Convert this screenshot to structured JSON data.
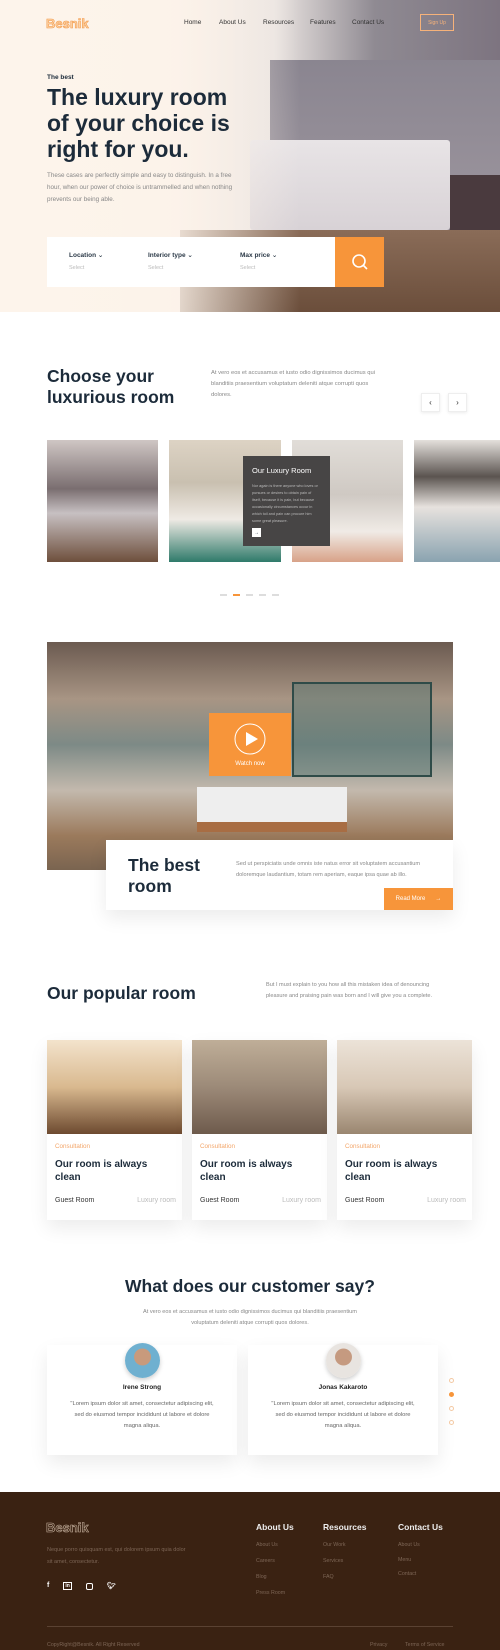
{
  "brand": "Besnik",
  "nav": {
    "items": [
      "Home",
      "About Us",
      "Resources",
      "Features",
      "Contact Us"
    ],
    "signup": "Sign Up"
  },
  "hero": {
    "eyebrow": "The best",
    "title_lines": [
      "The luxury room",
      "of your choice is",
      "right for you."
    ],
    "description": "These cases are perfectly simple and easy to distinguish. In a free hour, when our power of choice is untrammelled and when nothing prevents our being able.",
    "search": {
      "fields": [
        {
          "label": "Location",
          "value": "Select"
        },
        {
          "label": "Interior type",
          "value": "Select"
        },
        {
          "label": "Max price",
          "value": "Select"
        }
      ],
      "button_icon": "search-icon"
    }
  },
  "choose": {
    "title_lines": [
      "Choose your",
      "luxurious room"
    ],
    "description": "At vero eos et accusamus et iusto odio dignissimos ducimus qui blanditiis praesentium voluptatum deleniti atque corrupti quos dolores.",
    "prev": "‹",
    "next": "›",
    "overlay": {
      "title": "Our Luxury Room",
      "text": "Nor again is there anyone who loves or pursues or desires to obtain pain of itself, because it is pain, but because occasionally circumstances occur in which toil and pain can procure him some great pleasure.",
      "arrow": "→"
    },
    "active_dot": 1,
    "dot_count": 5
  },
  "video": {
    "watch": "Watch now",
    "title_lines": [
      "The best",
      "room"
    ],
    "description": "Sed ut perspiciatis unde omnis iste natus error sit voluptatem accusantium doloremque laudantium, totam rem aperiam, eaque ipsa quae ab illo.",
    "read_more": "Read More"
  },
  "popular": {
    "title": "Our popular room",
    "description": "But I must explain to you how all this mistaken idea of denouncing pleasure and praising pain was born and I will give you a complete.",
    "cards": [
      {
        "category": "Consultation",
        "title": "Our room is always clean",
        "type": "Guest Room",
        "tag": "Luxury room"
      },
      {
        "category": "Consultation",
        "title": "Our room is always clean",
        "type": "Guest Room",
        "tag": "Luxury room"
      },
      {
        "category": "Consultation",
        "title": "Our room is always clean",
        "type": "Guest Room",
        "tag": "Luxury room"
      }
    ]
  },
  "testimonials": {
    "title": "What does our customer say?",
    "description": "At vero eos et accusamus et iusto odio dignissimos ducimus qui blanditiis praesentium voluptatum deleniti atque corrupti quos dolores.",
    "items": [
      {
        "name": "Irene Strong",
        "quote": "\"Lorem ipsum dolor sit amet, consectetur adipiscing elit, sed do eiusmod tempor incididunt ut labore et dolore magna aliqua."
      },
      {
        "name": "Jonas Kakaroto",
        "quote": "\"Lorem ipsum dolor sit amet, consectetur adipiscing elit, sed do eiusmod tempor incididunt ut labore et dolore magna aliqua."
      }
    ],
    "active_dot": 1
  },
  "footer": {
    "brand": "Besnik",
    "description": "Neque porro quisquam est, qui dolorem ipsum quia dolor sit amet, consectetur.",
    "social": [
      "f",
      "in",
      "ig",
      "tw"
    ],
    "columns": [
      {
        "title": "About Us",
        "links": [
          "About Us",
          "Careers",
          "Blog",
          "Press Room"
        ]
      },
      {
        "title": "Resources",
        "links": [
          "Our Work",
          "Services",
          "FAQ"
        ]
      },
      {
        "title": "Contact Us",
        "links": [
          "About Us",
          "Menu",
          "Contact"
        ]
      }
    ],
    "copyright": "CopyRight@Besnik. All Right Reserved",
    "bottom_links": [
      "Privacy",
      "Terms of Service"
    ]
  },
  "colors": {
    "accent": "#f7953a",
    "footer_bg": "#3a2212",
    "heading": "#1c2b3a"
  }
}
